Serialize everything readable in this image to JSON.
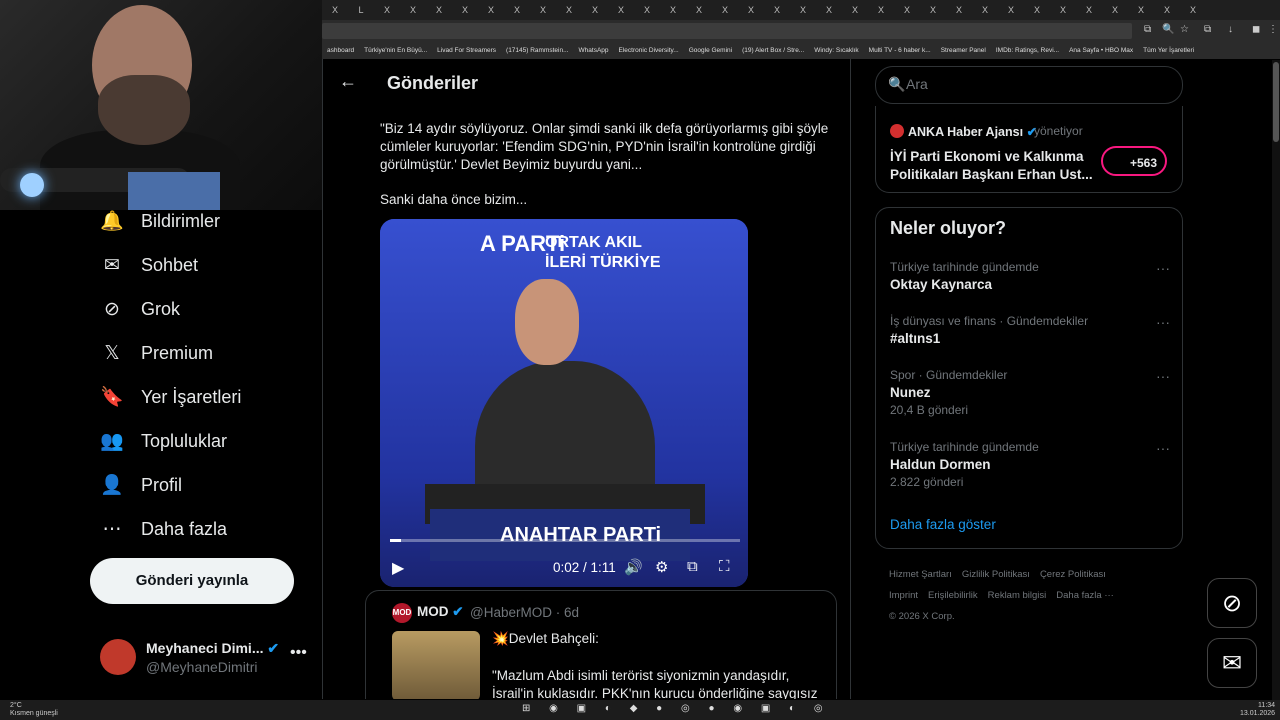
{
  "browser": {
    "tabs": [
      "X",
      "L",
      "X",
      "X",
      "X",
      "X",
      "X",
      "X",
      "X",
      "X",
      "X",
      "X",
      "X",
      "X",
      "X",
      "X",
      "X",
      "X",
      "X",
      "X",
      "X",
      "X",
      "X",
      "X",
      "X",
      "X",
      "X",
      "X",
      "X",
      "X",
      "X",
      "X",
      "X",
      "X"
    ],
    "bookmarks": [
      "ashboard",
      "Türkiye'nin En Büyü...",
      "Livad For Streamers",
      "(17145) Rammstein...",
      "WhatsApp",
      "Electronic Diversity...",
      "Google Gemini",
      "(19) Alert Box / Stre...",
      "Windy: Sıcaklık",
      "Multi TV - 6 haber k...",
      "Streamer Panel",
      "IMDb: Ratings, Revi...",
      "Ana Sayfa • HBO Max",
      "Tüm Yer İşaretleri"
    ]
  },
  "nav": {
    "items": [
      {
        "label": "Bildirimler",
        "icon": "bell-icon"
      },
      {
        "label": "Sohbet",
        "icon": "mail-icon"
      },
      {
        "label": "Grok",
        "icon": "grok-icon"
      },
      {
        "label": "Premium",
        "icon": "x-logo-icon"
      },
      {
        "label": "Yer İşaretleri",
        "icon": "bookmark-icon"
      },
      {
        "label": "Topluluklar",
        "icon": "people-icon"
      },
      {
        "label": "Profil",
        "icon": "person-icon"
      },
      {
        "label": "Daha fazla",
        "icon": "more-circle-icon"
      }
    ],
    "post_button": "Gönderi yayınla"
  },
  "profile": {
    "name": "Meyhaneci Dimi...",
    "handle": "@MeyhaneDimitri"
  },
  "main": {
    "title": "Gönderiler",
    "tweet_text": "\"Biz 14 aydır söylüyoruz. Onlar şimdi sanki ilk defa görüyorlarmış gibi şöyle cümleler kuruyorlar: 'Efendim SDG'nin, PYD'nin İsrail'in kontrolüne girdiği görülmüştür.' Devlet Beyimiz buyurdu yani...",
    "tweet_text2": "Sanki daha önce bizim...",
    "video": {
      "logo": "A PARTi",
      "slogan_line1": "ORTAK AKIL",
      "slogan_line2": "İLERİ TÜRKİYE",
      "banner": "ANAHTAR PARTi",
      "time": "0:02 / 1:11",
      "progress": 0.03
    },
    "quote": {
      "avatar": "MOD",
      "name": "MOD",
      "handle": "@HaberMOD · 6d",
      "line1": "💥Devlet Bahçeli:",
      "line2": "\"Mazlum Abdi isimli terörist siyonizmin yandaşıdır, İsrail'in kuklasıdır. PKK'nın kurucu önderliğine saygısız"
    }
  },
  "right": {
    "search_placeholder": "Ara",
    "live": {
      "name": "ANKA Haber Ajansı",
      "role": "yönetiyor",
      "title": "İYİ Parti Ekonomi ve Kalkınma Politikaları Başkanı Erhan Ust...",
      "count": "+563"
    },
    "trends_title": "Neler oluyor?",
    "trends": [
      {
        "context": "Türkiye tarihinde gündemde",
        "name": "Oktay Kaynarca",
        "posts": ""
      },
      {
        "context": "İş dünyası ve finans · Gündemdekiler",
        "name": "#altıns1",
        "posts": ""
      },
      {
        "context": "Spor · Gündemdekiler",
        "name": "Nunez",
        "posts": "20,4 B gönderi"
      },
      {
        "context": "Türkiye tarihinde gündemde",
        "name": "Haldun Dormen",
        "posts": "2.822 gönderi"
      }
    ],
    "show_more": "Daha fazla göster",
    "footer": [
      "Hizmet Şartları",
      "Gizlilik Politikası",
      "Çerez Politikası",
      "Imprint",
      "Erişilebilirlik",
      "Reklam bilgisi",
      "Daha fazla ···",
      "© 2026 X Corp."
    ]
  },
  "taskbar": {
    "temp": "2°C",
    "weather": "Kısmen güneşli",
    "time": "11:34",
    "date": "13.01.2026"
  }
}
